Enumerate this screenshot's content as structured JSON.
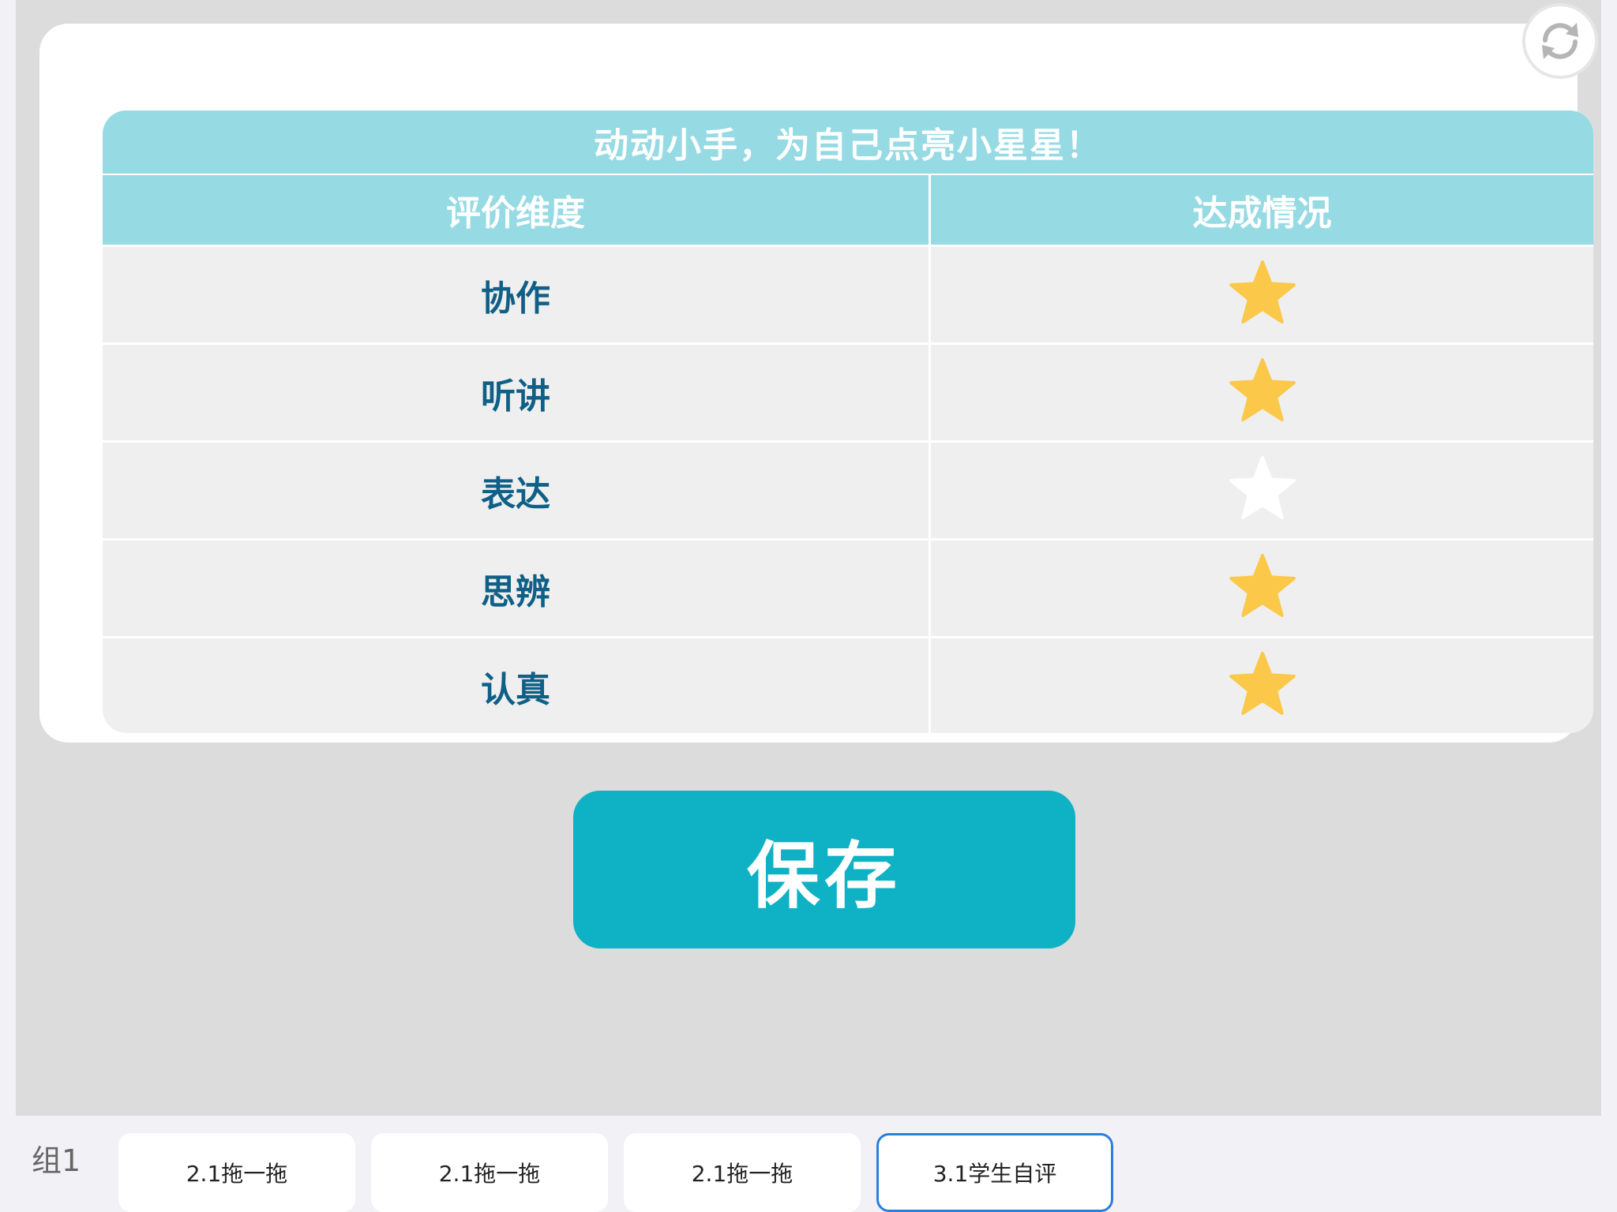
{
  "banner_title": "动动小手，为自己点亮小星星！",
  "columns": {
    "dimension": "评价维度",
    "status": "达成情况"
  },
  "rows": [
    {
      "label": "协作",
      "star": "filled"
    },
    {
      "label": "听讲",
      "star": "filled"
    },
    {
      "label": "表达",
      "star": "empty"
    },
    {
      "label": "思辨",
      "star": "filled"
    },
    {
      "label": "认真",
      "star": "filled"
    }
  ],
  "save_label": "保存",
  "group_label": "组1",
  "tabs": [
    {
      "label": "2.1拖一拖",
      "active": false
    },
    {
      "label": "2.1拖一拖",
      "active": false
    },
    {
      "label": "2.1拖一拖",
      "active": false
    },
    {
      "label": "3.1学生自评",
      "active": true
    }
  ],
  "colors": {
    "header_bg": "#96dae4",
    "label_text": "#0f5f86",
    "star_filled": "#fcc849",
    "star_empty": "#ffffff",
    "save_bg": "#0fb1c5",
    "active_tab_border": "#2a7fe0"
  },
  "icons": {
    "refresh": "refresh-icon",
    "star": "star-icon"
  }
}
